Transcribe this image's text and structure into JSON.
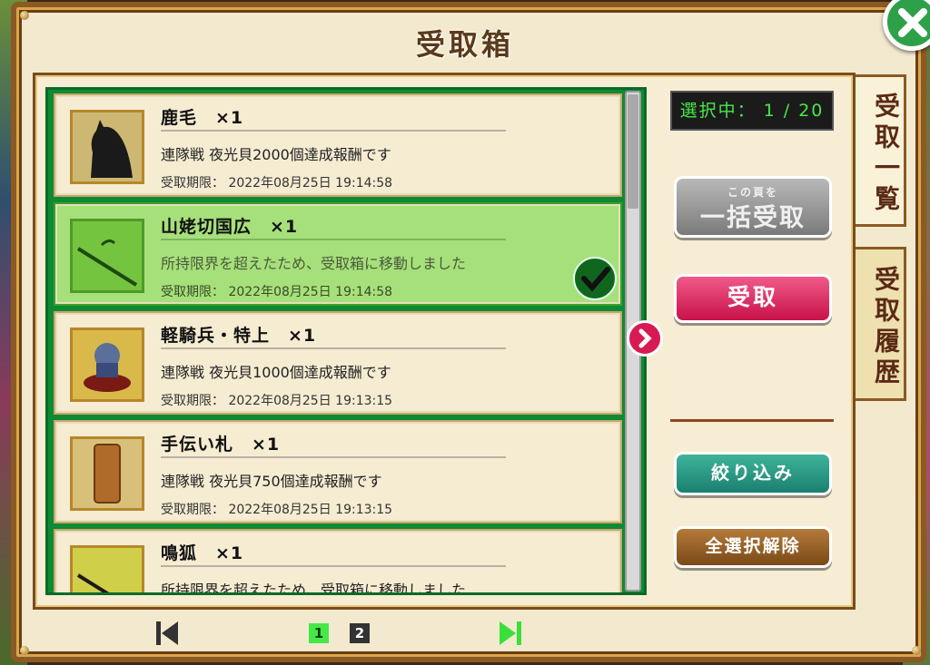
{
  "window": {
    "title": "受取箱"
  },
  "counter": {
    "text": "選択中： 1 / 20"
  },
  "buttons": {
    "bulk_small": "この頁を",
    "bulk_big": "一括受取",
    "receive": "受取",
    "filter": "絞り込み",
    "deselect_all": "全選択解除"
  },
  "tabs": [
    {
      "label": "受取一覧"
    },
    {
      "label": "受取履歴"
    }
  ],
  "items": [
    {
      "name": "鹿毛　×1",
      "desc": "連隊戦 夜光貝2000個達成報酬です",
      "deadline": "受取期限： 2022年08月25日 19:14:58",
      "icon": "horse-icon",
      "selected": false
    },
    {
      "name": "山姥切国広　×1",
      "desc": "所持限界を超えたため、受取箱に移動しました",
      "deadline": "受取期限： 2022年08月25日 19:14:58",
      "icon": "sword-icon",
      "selected": true
    },
    {
      "name": "軽騎兵・特上　×1",
      "desc": "連隊戦 夜光貝1000個達成報酬です",
      "deadline": "受取期限： 2022年08月25日 19:13:15",
      "icon": "cavalry-icon",
      "selected": false
    },
    {
      "name": "手伝い札　×1",
      "desc": "連隊戦 夜光貝750個達成報酬です",
      "deadline": "受取期限： 2022年08月25日 19:13:15",
      "icon": "helper-tag-icon",
      "selected": false
    },
    {
      "name": "鳴狐　×1",
      "desc": "所持限界を超えたため、受取箱に移動しました",
      "deadline": "",
      "icon": "sword-icon",
      "selected": false
    }
  ],
  "pagination": {
    "pages": [
      "1",
      "2"
    ],
    "current": "1"
  },
  "colors": {
    "accent_green": "#0f8a34",
    "selected_bg": "#a6e07a",
    "receive_pink": "#d81a54"
  }
}
